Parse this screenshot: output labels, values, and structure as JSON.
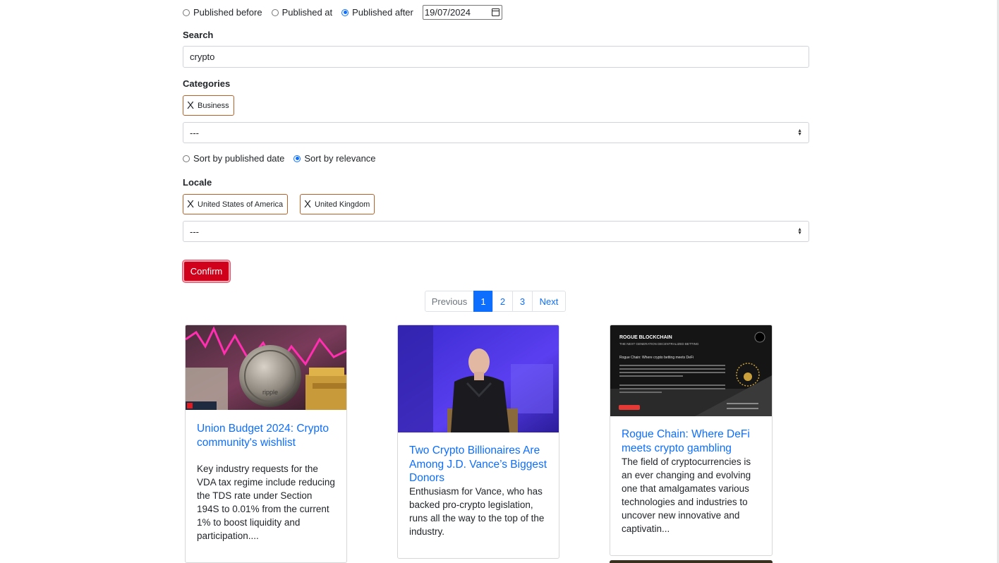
{
  "filters": {
    "published_options": [
      {
        "label": "Published before",
        "checked": false
      },
      {
        "label": "Published at",
        "checked": false
      },
      {
        "label": "Published after",
        "checked": true
      }
    ],
    "date_value": "19/07/2024",
    "search_label": "Search",
    "search_value": "crypto",
    "categories_label": "Categories",
    "categories_selected": [
      "Business"
    ],
    "categories_select_value": "---",
    "sort_options": [
      {
        "label": "Sort by published date",
        "checked": false
      },
      {
        "label": "Sort by relevance",
        "checked": true
      }
    ],
    "locale_label": "Locale",
    "locales_selected": [
      "United States of America",
      "United Kingdom"
    ],
    "locale_select_value": "---",
    "confirm_label": "Confirm",
    "chip_remove_glyph": "X"
  },
  "pagination": {
    "previous": "Previous",
    "pages": [
      "1",
      "2",
      "3"
    ],
    "active_page": "1",
    "next": "Next"
  },
  "articles": [
    {
      "title": "Union Budget 2024: Crypto community's wishlist",
      "description": "Key industry requests for the VDA tax regime include reducing the TDS rate under Section 194S to 0.01% from the current 1% to boost liquidity and participation....",
      "image_text": "ripple"
    },
    {
      "title": "Two Crypto Billionaires Are Among J.D. Vance’s Biggest Donors",
      "description": "Enthusiasm for Vance, who has backed pro-crypto legislation, runs all the way to the top of the industry."
    },
    {
      "title": "Rogue Chain: Where DeFi meets crypto gambling",
      "description": "The field of cryptocurrencies is an ever changing and evolving one that amalgamates various technologies and industries to uncover new innovative and captivatin...",
      "image_heading": "ROGUE BLOCKCHAIN",
      "image_subheading": "THE NEXT GENERATION DECENTRALIZED BETTING",
      "image_caption": "Rogue Chain: Where crypto betting meets DeFi"
    }
  ],
  "colors": {
    "link": "#0d6efd",
    "confirm_bg": "#d0021b",
    "chip_border": "#b5622a"
  }
}
